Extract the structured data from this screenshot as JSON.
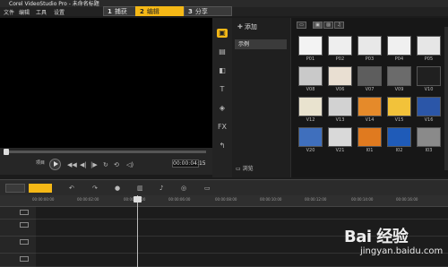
{
  "window": {
    "title": "Corel VideoStudio Pro - 未命名标题"
  },
  "menu": [
    "文件",
    "编辑",
    "工具",
    "设置"
  ],
  "steps": [
    {
      "num": "1",
      "label": "捕获",
      "active": false
    },
    {
      "num": "2",
      "label": "编辑",
      "active": true
    },
    {
      "num": "3",
      "label": "分享",
      "active": false
    }
  ],
  "player": {
    "mode_label": "项目",
    "timecode": "00:00:04:15",
    "buttons": [
      "▶",
      "◀◀",
      "◀|",
      "|▶",
      "↻",
      "⟲",
      "◁)"
    ]
  },
  "library": {
    "add_label": "添加",
    "folder": "示例",
    "browse_label": "浏览"
  },
  "gallery": {
    "thumbs": [
      {
        "label": "P01",
        "color": "#f3f3f3"
      },
      {
        "label": "P02",
        "color": "#eeeeee"
      },
      {
        "label": "P03",
        "color": "#e8e8e8"
      },
      {
        "label": "P04",
        "color": "#f0f0f0"
      },
      {
        "label": "P05",
        "color": "#e6e6e6"
      },
      {
        "label": "V08",
        "color": "#c9c9c9"
      },
      {
        "label": "V06",
        "color": "#e9dfd2"
      },
      {
        "label": "V07",
        "color": "#5d5d5d"
      },
      {
        "label": "V09",
        "color": "#6b6b6b"
      },
      {
        "label": "V10",
        "color": "#202020"
      },
      {
        "label": "V12",
        "color": "#e9e3cf"
      },
      {
        "label": "V13",
        "color": "#d2d2d2"
      },
      {
        "label": "V14",
        "color": "#e58a2a"
      },
      {
        "label": "V15",
        "color": "#f2c23a"
      },
      {
        "label": "V16",
        "color": "#2b56a8"
      },
      {
        "label": "V20",
        "color": "#3f6fbd"
      },
      {
        "label": "V21",
        "color": "#d9d9d9"
      },
      {
        "label": "I01",
        "color": "#e07a1f"
      },
      {
        "label": "I02",
        "color": "#1f5bb8"
      },
      {
        "label": "I03",
        "color": "#8a8a8a"
      }
    ]
  },
  "timeline": {
    "ruler": [
      "00:00:00:00",
      "00:00:02:00",
      "00:00:04:00",
      "00:00:06:00",
      "00:00:08:00",
      "00:00:10:00",
      "00:00:12:00",
      "00:00:14:00",
      "00:00:16:00"
    ]
  },
  "watermark": {
    "logo": "Bai  经验",
    "url": "jingyan.baidu.com"
  }
}
